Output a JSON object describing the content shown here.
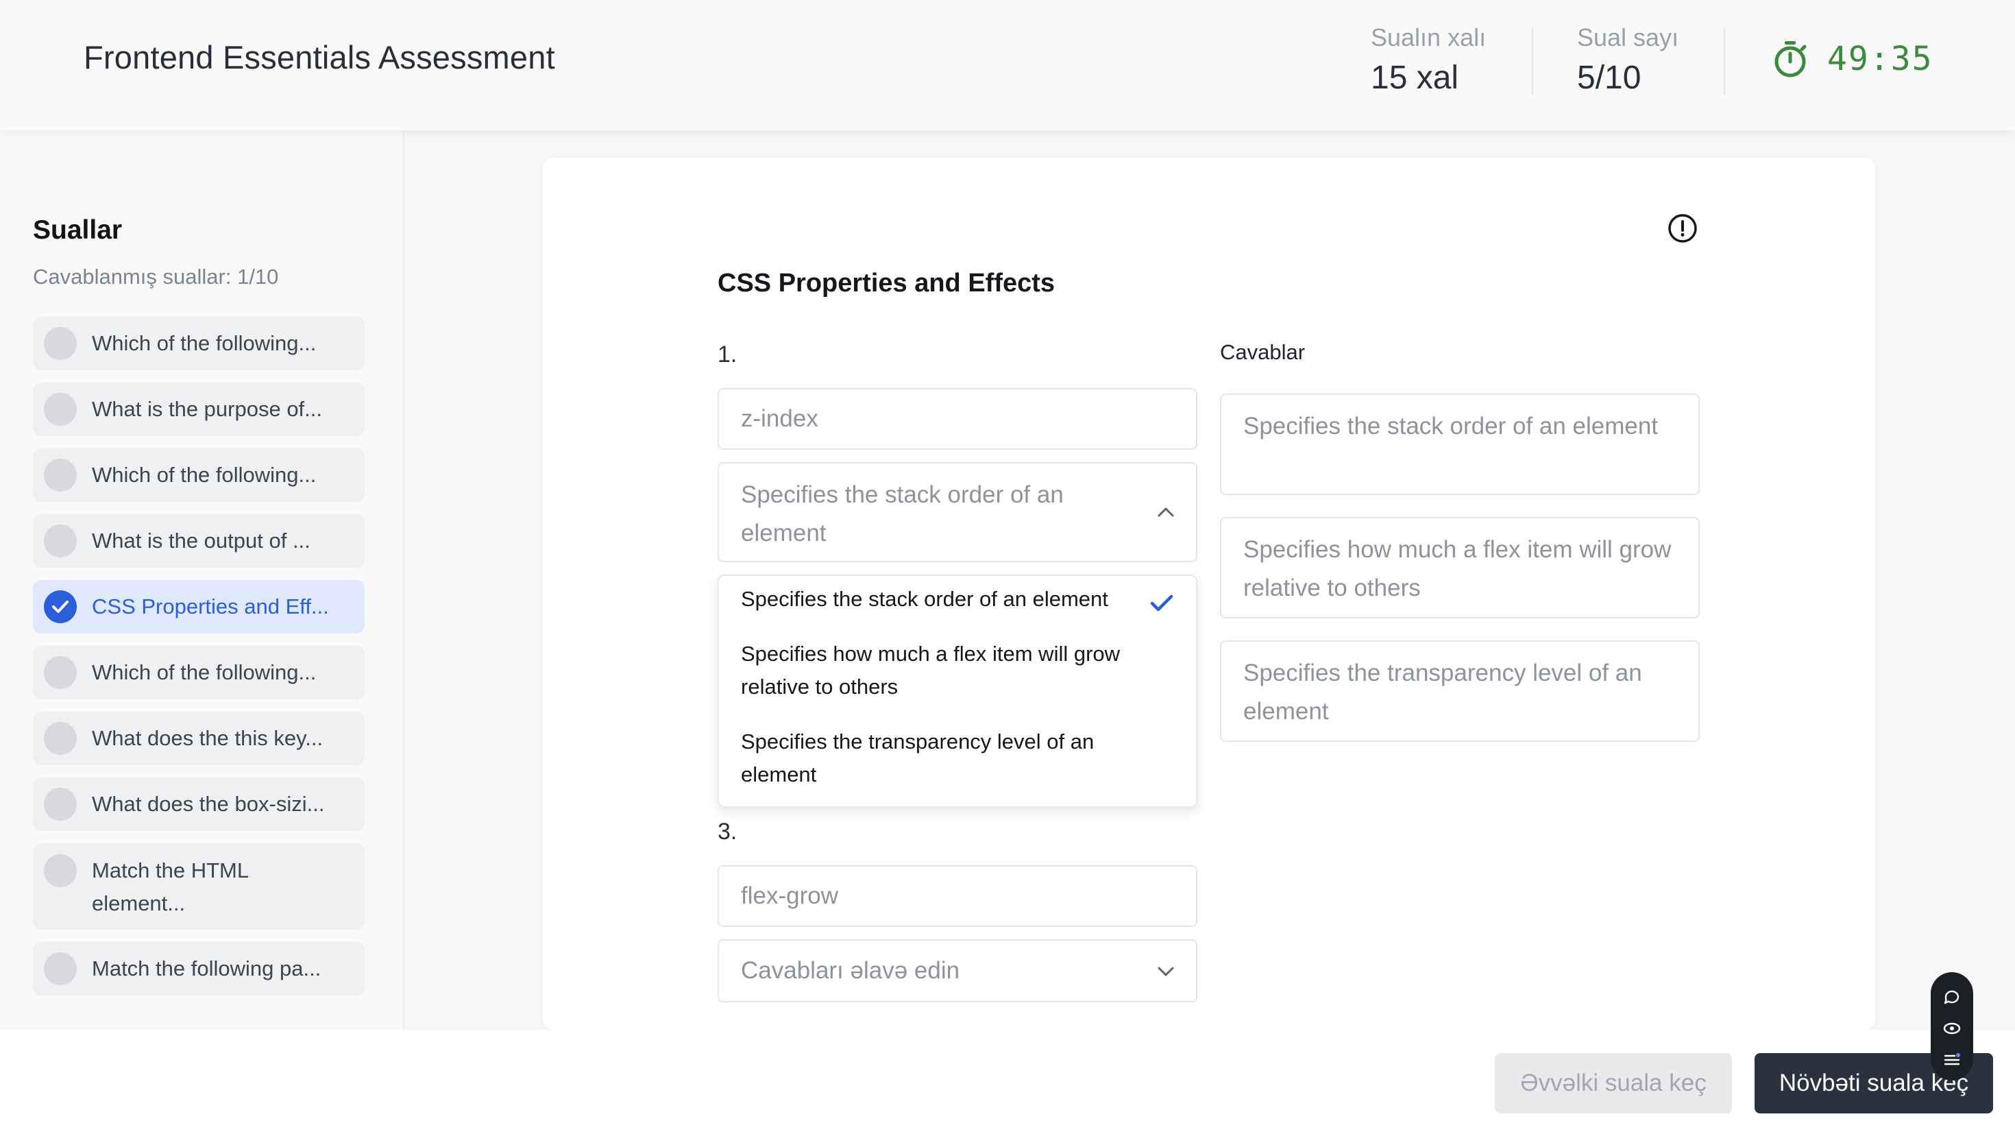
{
  "header": {
    "title": "Frontend Essentials Assessment",
    "score_label": "Sualın xalı",
    "score_value": "15 xal",
    "count_label": "Sual sayı",
    "count_value": "5/10",
    "timer": "49:35",
    "timer_icon": "stopwatch-icon"
  },
  "sidebar": {
    "title": "Suallar",
    "answered": "Cavablanmış suallar: 1/10",
    "items": [
      {
        "label": "Which of the following...",
        "done": false
      },
      {
        "label": "What is the purpose of...",
        "done": false
      },
      {
        "label": "Which of the following...",
        "done": false
      },
      {
        "label": "What is the output of ...",
        "done": false
      },
      {
        "label": "CSS Properties and Eff...",
        "done": true,
        "active": true
      },
      {
        "label": "Which of the following...",
        "done": false
      },
      {
        "label": "What does the this key...",
        "done": false
      },
      {
        "label": "What does the box-sizi...",
        "done": false
      },
      {
        "label": "Match the HTML element...",
        "done": false
      },
      {
        "label": "Match the following pa...",
        "done": false
      }
    ]
  },
  "question": {
    "title": "CSS Properties and Effects",
    "info_icon": "info-icon",
    "pairs": [
      {
        "number": "1.",
        "term": "z-index",
        "selected": "Specifies the stack order of an element"
      },
      {
        "number": "3.",
        "term": "flex-grow",
        "placeholder": "Cavabları əlavə edin"
      }
    ],
    "dropdown_options": [
      "Specifies the stack order of an element",
      "Specifies how much a flex item will grow relative to others",
      "Specifies the transparency level of an element"
    ],
    "answers_label": "Cavablar",
    "answers": [
      "Specifies the stack order of an element",
      "Specifies how much a flex item will grow relative to others",
      "Specifies the transparency level of an element"
    ]
  },
  "footer": {
    "prev_label": "Əvvəlki suala keç",
    "next_label": "Növbəti suala keç"
  },
  "colors": {
    "accent": "#2b5fd9",
    "timer": "#3c8b3c",
    "primary_button": "#2a323f"
  }
}
